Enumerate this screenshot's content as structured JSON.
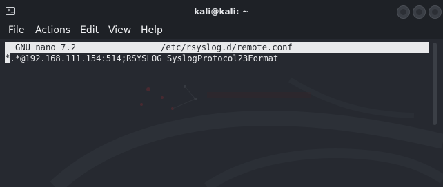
{
  "window": {
    "title": "kali@kali: ~",
    "terminal_icon_glyph": ">_"
  },
  "menu": {
    "items": [
      "File",
      "Actions",
      "Edit",
      "View",
      "Help"
    ]
  },
  "nano": {
    "version": "GNU nano 7.2",
    "filename": "/etc/rsyslog.d/remote.conf"
  },
  "content": {
    "cursor_char": "*",
    "line1_rest": ".*@192.168.111.154:514;RSYSLOG_SyslogProtocol23Format"
  },
  "colors": {
    "titlebar": "#1e2126",
    "terminal_bg": "#262930",
    "text": "#e8e9eb",
    "header_bg": "#e8e9eb"
  }
}
